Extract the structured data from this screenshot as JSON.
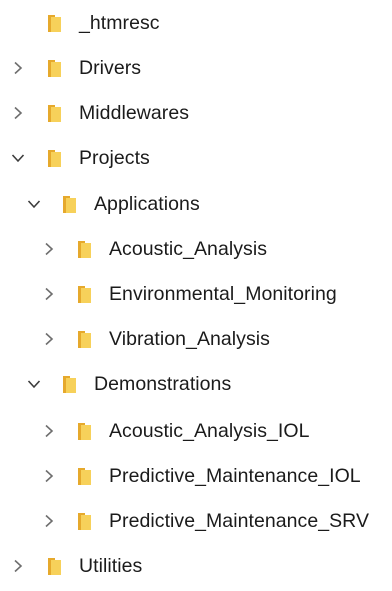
{
  "tree": {
    "items": [
      {
        "label": "_htmresc",
        "icon": "folder-icon",
        "expander": "none"
      },
      {
        "label": "Drivers",
        "icon": "folder-icon",
        "expander": "chevron-right-icon"
      },
      {
        "label": "Middlewares",
        "icon": "folder-icon",
        "expander": "chevron-right-icon"
      },
      {
        "label": "Projects",
        "icon": "folder-icon",
        "expander": "chevron-down-icon"
      },
      {
        "label": "Applications",
        "icon": "folder-icon",
        "expander": "chevron-down-icon"
      },
      {
        "label": "Acoustic_Analysis",
        "icon": "folder-icon",
        "expander": "chevron-right-icon"
      },
      {
        "label": "Environmental_Monitoring",
        "icon": "folder-icon",
        "expander": "chevron-right-icon"
      },
      {
        "label": "Vibration_Analysis",
        "icon": "folder-icon",
        "expander": "chevron-right-icon"
      },
      {
        "label": "Demonstrations",
        "icon": "folder-icon",
        "expander": "chevron-down-icon"
      },
      {
        "label": "Acoustic_Analysis_IOL",
        "icon": "folder-icon",
        "expander": "chevron-right-icon"
      },
      {
        "label": "Predictive_Maintenance_IOL",
        "icon": "folder-icon",
        "expander": "chevron-right-icon"
      },
      {
        "label": "Predictive_Maintenance_SRV",
        "icon": "folder-icon",
        "expander": "chevron-right-icon"
      },
      {
        "label": "Utilities",
        "icon": "folder-icon",
        "expander": "chevron-right-icon"
      }
    ]
  },
  "colors": {
    "folder_front": "#f7d15a",
    "folder_back": "#e6a92c",
    "chevron": "#6e6e6e",
    "text": "#1b1b1b"
  }
}
